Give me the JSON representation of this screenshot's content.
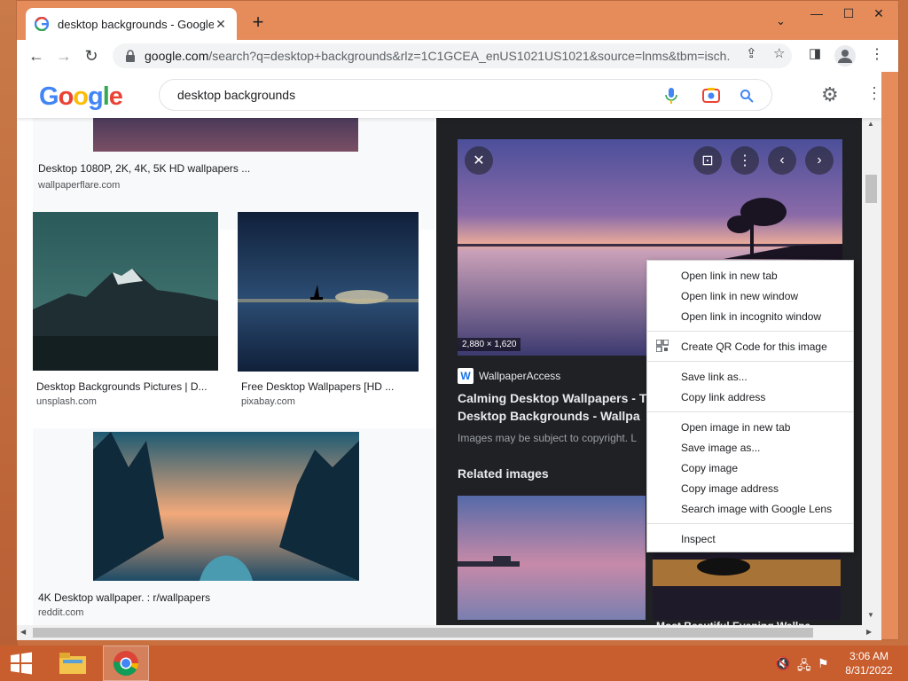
{
  "browser": {
    "tab_title": "desktop backgrounds - Google Search",
    "url_host": "google.com",
    "url_rest": "/search?q=desktop+backgrounds&rlz=1C1GCEA_enUS1021US1021&source=lnms&tbm=isch...",
    "tab_close": "✕",
    "new_tab": "+",
    "tab_search": "⌄",
    "minimize": "—",
    "restore": "☐",
    "close": "✕"
  },
  "google": {
    "logo": [
      "G",
      "o",
      "o",
      "g",
      "l",
      "e"
    ],
    "logo_colors": [
      "#4285f4",
      "#ea4335",
      "#fbbc05",
      "#4285f4",
      "#34a853",
      "#ea4335"
    ],
    "query": "desktop backgrounds"
  },
  "results": [
    {
      "title": "Desktop 1080P, 2K, 4K, 5K HD wallpapers ...",
      "source": "wallpaperflare.com"
    },
    {
      "title": "Desktop Backgrounds Pictures | D...",
      "source": "unsplash.com"
    },
    {
      "title": "Free Desktop Wallpapers [HD ...",
      "source": "pixabay.com"
    },
    {
      "title": "4K Desktop wallpaper. : r/wallpapers",
      "source": "reddit.com"
    }
  ],
  "preview": {
    "dimensions": "2,880 × 1,620",
    "site_logo": "W",
    "site": "WallpaperAccess",
    "title_line1": "Calming Desktop Wallpapers - T",
    "title_line2": "Desktop Backgrounds - Wallpa",
    "copyright": "Images may be subject to copyright. L",
    "related": "Related images",
    "bottom_caption": "Most Beautiful Evening Wallpa..."
  },
  "context_menu": {
    "group1": [
      "Open link in new tab",
      "Open link in new window",
      "Open link in incognito window"
    ],
    "group2": [
      "Create QR Code for this image"
    ],
    "group3": [
      "Save link as...",
      "Copy link address"
    ],
    "group4": [
      "Open image in new tab",
      "Save image as...",
      "Copy image",
      "Copy image address",
      "Search image with Google Lens"
    ],
    "group5": [
      "Inspect"
    ]
  },
  "taskbar": {
    "time": "3:06 AM",
    "date": "8/31/2022"
  },
  "colors": {
    "accent": "#1a73e8",
    "desktop": "#c8703f",
    "panel": "#202124"
  }
}
